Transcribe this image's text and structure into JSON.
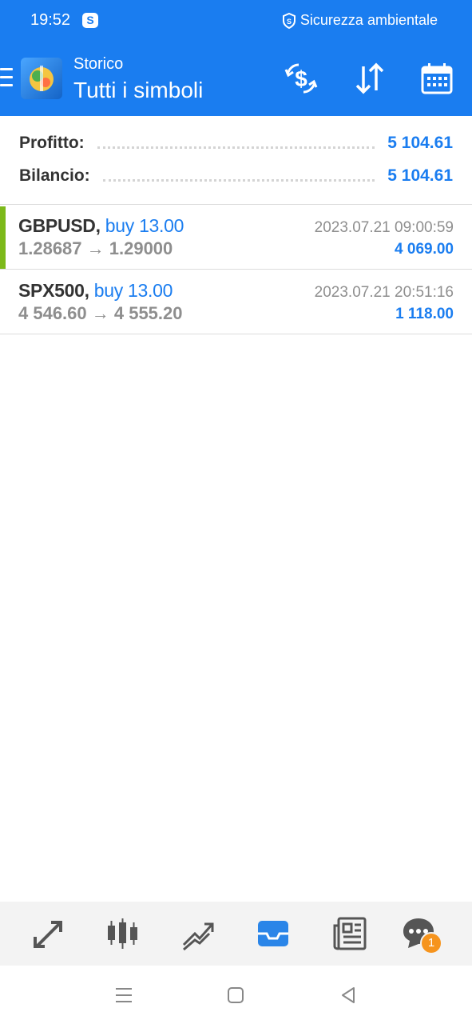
{
  "status_bar": {
    "time": "19:52",
    "notification_badge": "S",
    "security_text": "Sicurezza ambientale"
  },
  "header": {
    "subtitle": "Storico",
    "title": "Tutti i simboli",
    "icons": [
      "menu-icon",
      "app-logo",
      "currency-exchange-icon",
      "sort-icon",
      "calendar-icon"
    ]
  },
  "summary": {
    "profit_label": "Profitto:",
    "profit_value": "5 104.61",
    "balance_label": "Bilancio:",
    "balance_value": "5 104.61"
  },
  "trades": [
    {
      "symbol": "GBPUSD,",
      "side": "buy 13.00",
      "prices": "1.28687 → 1.29000",
      "time": "2023.07.21 09:00:59",
      "profit": "4 069.00"
    },
    {
      "symbol": "SPX500,",
      "side": "buy 13.00",
      "prices": "4 546.60 → 4 555.20",
      "time": "2023.07.21 20:51:16",
      "profit": "1 118.00"
    }
  ],
  "bottom_nav": {
    "items": [
      "quotes-icon",
      "chart-icon",
      "trade-icon",
      "history-icon",
      "news-icon",
      "messages-icon"
    ],
    "active": "history-icon",
    "messages_badge": "1"
  },
  "system_nav": [
    "recents-icon",
    "home-icon",
    "back-icon"
  ],
  "colors": {
    "accent": "#1a7df0",
    "profit_bar": "#7cb91a",
    "badge": "#f6941d"
  }
}
